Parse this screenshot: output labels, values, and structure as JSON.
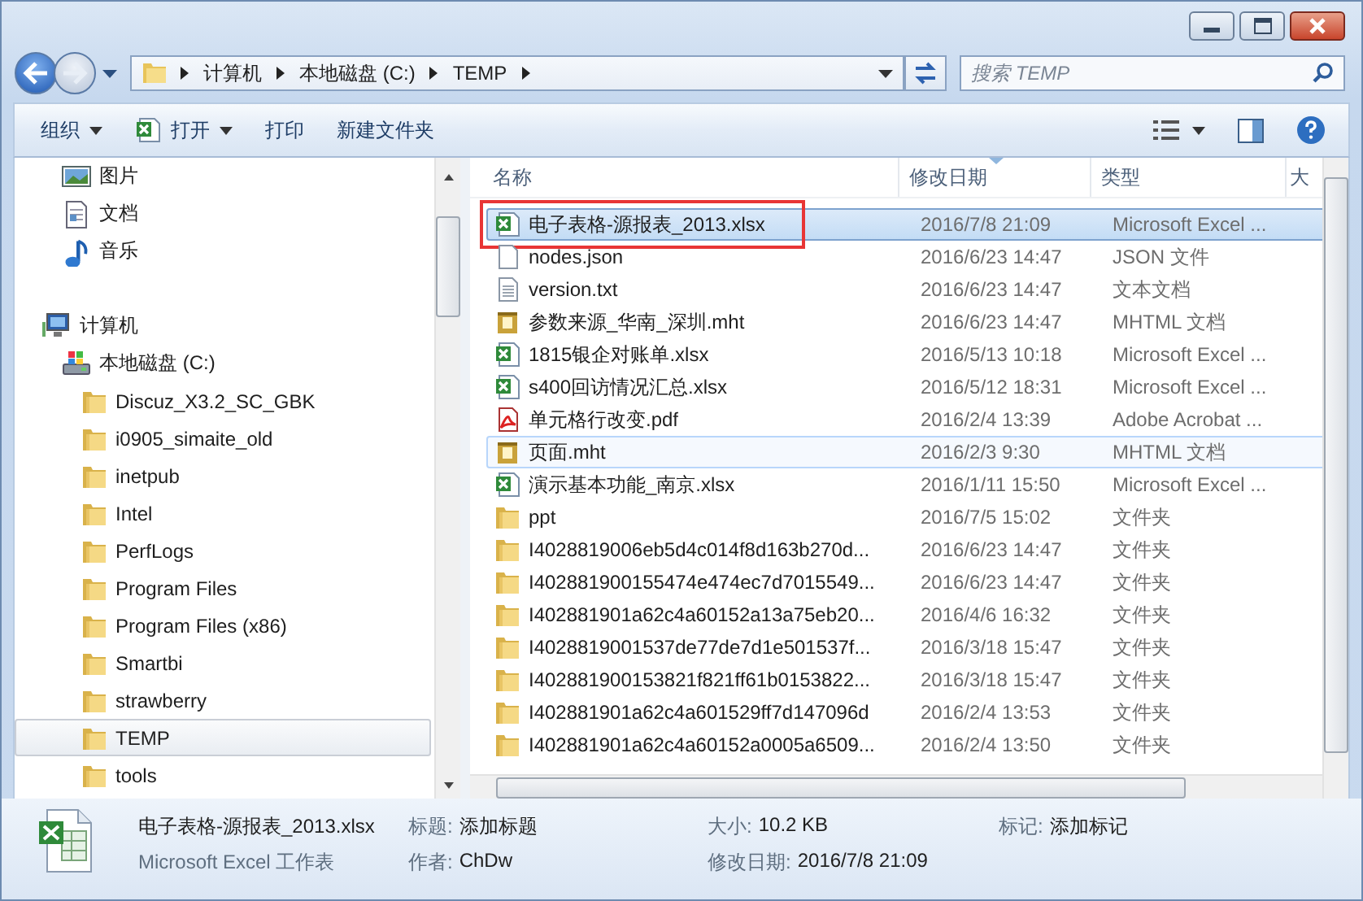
{
  "address_bar": {
    "crumbs": [
      "计算机",
      "本地磁盘 (C:)",
      "TEMP"
    ]
  },
  "search": {
    "placeholder": "搜索 TEMP"
  },
  "toolbar": {
    "items": [
      {
        "label": "组织",
        "kind": "menu"
      },
      {
        "label": "打开",
        "kind": "open"
      },
      {
        "label": "打印",
        "kind": "plain"
      },
      {
        "label": "新建文件夹",
        "kind": "plain"
      }
    ]
  },
  "sidebar": {
    "libraries": [
      {
        "label": "图片",
        "kind": "pictures"
      },
      {
        "label": "文档",
        "kind": "documents"
      },
      {
        "label": "音乐",
        "kind": "music"
      }
    ],
    "tree": [
      {
        "label": "计算机",
        "kind": "computer",
        "selected": false,
        "children": [
          {
            "label": "本地磁盘 (C:)",
            "kind": "disk",
            "selected": false,
            "children": [
              {
                "label": "Discuz_X3.2_SC_GBK",
                "kind": "folder",
                "selected": false
              },
              {
                "label": "i0905_simaite_old",
                "kind": "folder",
                "selected": false
              },
              {
                "label": "inetpub",
                "kind": "folder",
                "selected": false
              },
              {
                "label": "Intel",
                "kind": "folder",
                "selected": false
              },
              {
                "label": "PerfLogs",
                "kind": "folder",
                "selected": false
              },
              {
                "label": "Program Files",
                "kind": "folder",
                "selected": false
              },
              {
                "label": "Program Files (x86)",
                "kind": "folder",
                "selected": false
              },
              {
                "label": "Smartbi",
                "kind": "folder",
                "selected": false
              },
              {
                "label": "strawberry",
                "kind": "folder",
                "selected": false
              },
              {
                "label": "TEMP",
                "kind": "folder",
                "selected": true
              },
              {
                "label": "tools",
                "kind": "folder",
                "selected": false
              }
            ]
          }
        ]
      }
    ]
  },
  "file_list": {
    "columns": [
      {
        "label": "名称",
        "sorted": false
      },
      {
        "label": "修改日期",
        "sorted": true
      },
      {
        "label": "类型",
        "sorted": false
      },
      {
        "label": "大",
        "sorted": false
      }
    ],
    "rows": [
      {
        "name": "电子表格-源报表_2013.xlsx",
        "date": "2016/7/8 21:09",
        "type": "Microsoft Excel ...",
        "kind": "excel",
        "selected": true,
        "hovered": false,
        "marked": true
      },
      {
        "name": "nodes.json",
        "date": "2016/6/23 14:47",
        "type": "JSON 文件",
        "kind": "blank",
        "selected": false,
        "hovered": false,
        "marked": false
      },
      {
        "name": "version.txt",
        "date": "2016/6/23 14:47",
        "type": "文本文档",
        "kind": "text",
        "selected": false,
        "hovered": false,
        "marked": false
      },
      {
        "name": "参数来源_华南_深圳.mht",
        "date": "2016/6/23 14:47",
        "type": "MHTML 文档",
        "kind": "mht",
        "selected": false,
        "hovered": false,
        "marked": false
      },
      {
        "name": "1815银企对账单.xlsx",
        "date": "2016/5/13 10:18",
        "type": "Microsoft Excel ...",
        "kind": "excel",
        "selected": false,
        "hovered": false,
        "marked": false
      },
      {
        "name": "s400回访情况汇总.xlsx",
        "date": "2016/5/12 18:31",
        "type": "Microsoft Excel ...",
        "kind": "excel",
        "selected": false,
        "hovered": false,
        "marked": false
      },
      {
        "name": "单元格行改变.pdf",
        "date": "2016/2/4 13:39",
        "type": "Adobe Acrobat ...",
        "kind": "pdf",
        "selected": false,
        "hovered": false,
        "marked": false
      },
      {
        "name": "页面.mht",
        "date": "2016/2/3 9:30",
        "type": "MHTML 文档",
        "kind": "mht",
        "selected": false,
        "hovered": true,
        "marked": false
      },
      {
        "name": "演示基本功能_南京.xlsx",
        "date": "2016/1/11 15:50",
        "type": "Microsoft Excel ...",
        "kind": "excel",
        "selected": false,
        "hovered": false,
        "marked": false
      },
      {
        "name": "ppt",
        "date": "2016/7/5 15:02",
        "type": "文件夹",
        "kind": "folder",
        "selected": false,
        "hovered": false,
        "marked": false
      },
      {
        "name": "I4028819006eb5d4c014f8d163b270d...",
        "date": "2016/6/23 14:47",
        "type": "文件夹",
        "kind": "folder",
        "selected": false,
        "hovered": false,
        "marked": false
      },
      {
        "name": "I402881900155474e474ec7d7015549...",
        "date": "2016/6/23 14:47",
        "type": "文件夹",
        "kind": "folder",
        "selected": false,
        "hovered": false,
        "marked": false
      },
      {
        "name": "I402881901a62c4a60152a13a75eb20...",
        "date": "2016/4/6 16:32",
        "type": "文件夹",
        "kind": "folder",
        "selected": false,
        "hovered": false,
        "marked": false
      },
      {
        "name": "I4028819001537de77de7d1e501537f...",
        "date": "2016/3/18 15:47",
        "type": "文件夹",
        "kind": "folder",
        "selected": false,
        "hovered": false,
        "marked": false
      },
      {
        "name": "I402881900153821f821ff61b0153822...",
        "date": "2016/3/18 15:47",
        "type": "文件夹",
        "kind": "folder",
        "selected": false,
        "hovered": false,
        "marked": false
      },
      {
        "name": "I402881901a62c4a601529ff7d147096d",
        "date": "2016/2/4 13:53",
        "type": "文件夹",
        "kind": "folder",
        "selected": false,
        "hovered": false,
        "marked": false
      },
      {
        "name": "I402881901a62c4a60152a0005a6509...",
        "date": "2016/2/4 13:50",
        "type": "文件夹",
        "kind": "folder",
        "selected": false,
        "hovered": false,
        "marked": false
      }
    ]
  },
  "details": {
    "name": "电子表格-源报表_2013.xlsx",
    "type": "Microsoft Excel 工作表",
    "kind": "excel",
    "fields": [
      {
        "label": "标题:",
        "value": "添加标题"
      },
      {
        "label": "大小:",
        "value": "10.2 KB"
      },
      {
        "label": "标记:",
        "value": "添加标记"
      },
      {
        "label": "作者:",
        "value": "ChDw"
      },
      {
        "label": "修改日期:",
        "value": "2016/7/8 21:09"
      }
    ]
  }
}
